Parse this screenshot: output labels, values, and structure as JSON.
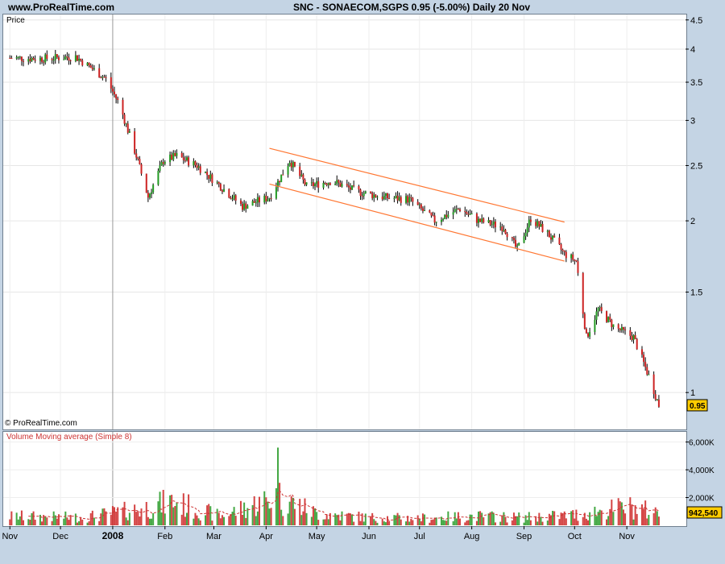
{
  "header": {
    "site": "www.ProRealTime.com",
    "title": "SNC - SONAECOM,SGPS   0.95 (-5.00%)   Daily  20 Nov"
  },
  "price_panel": {
    "label": "Price",
    "copyright": "© ProRealTime.com"
  },
  "volume_panel": {
    "label": "Volume Moving average (Simple 8)"
  },
  "colors": {
    "up": "#229922",
    "down": "#cc2222",
    "wick": "#000000",
    "channel": "#ff7733",
    "ma": "#cc3333",
    "last_badge": "#ffcc00"
  },
  "chart_data": [
    {
      "type": "candlestick",
      "title": "SNC - SONAECOM,SGPS",
      "ylabel": "Price",
      "scale": "log",
      "ylim": [
        0.87,
        4.6
      ],
      "yticks": [
        1,
        1.5,
        2,
        2.5,
        3,
        3.5,
        4,
        4.5
      ],
      "last_value": "0.95",
      "change": "-5.00%",
      "period": "Daily",
      "date": "20 Nov",
      "x_labels": [
        "Nov",
        "Dec",
        "2008",
        "Feb",
        "Mar",
        "Apr",
        "May",
        "Jun",
        "Jul",
        "Aug",
        "Sep",
        "Oct",
        "Nov"
      ],
      "close_path": [
        [
          "2007-11-01",
          3.86
        ],
        [
          "2007-11-20",
          3.85
        ],
        [
          "2007-12-10",
          3.88
        ],
        [
          "2007-12-28",
          3.55
        ],
        [
          "2008-01-05",
          3.2
        ],
        [
          "2008-01-15",
          2.6
        ],
        [
          "2008-01-22",
          2.2
        ],
        [
          "2008-01-31",
          2.55
        ],
        [
          "2008-02-08",
          2.6
        ],
        [
          "2008-02-20",
          2.5
        ],
        [
          "2008-03-05",
          2.3
        ],
        [
          "2008-03-18",
          2.12
        ],
        [
          "2008-04-03",
          2.2
        ],
        [
          "2008-04-15",
          2.55
        ],
        [
          "2008-04-25",
          2.3
        ],
        [
          "2008-05-10",
          2.35
        ],
        [
          "2008-05-25",
          2.25
        ],
        [
          "2008-06-10",
          2.2
        ],
        [
          "2008-06-25",
          2.18
        ],
        [
          "2008-07-10",
          2.0
        ],
        [
          "2008-07-25",
          2.1
        ],
        [
          "2008-08-05",
          2.0
        ],
        [
          "2008-08-20",
          1.95
        ],
        [
          "2008-08-28",
          1.78
        ],
        [
          "2008-09-05",
          2.02
        ],
        [
          "2008-09-15",
          1.9
        ],
        [
          "2008-09-25",
          1.75
        ],
        [
          "2008-10-02",
          1.7
        ],
        [
          "2008-10-08",
          1.25
        ],
        [
          "2008-10-15",
          1.4
        ],
        [
          "2008-10-25",
          1.3
        ],
        [
          "2008-11-05",
          1.25
        ],
        [
          "2008-11-15",
          1.05
        ],
        [
          "2008-11-20",
          0.95
        ]
      ],
      "channel": {
        "upper": [
          [
            "2008-04-03",
            2.68
          ],
          [
            "2008-09-25",
            1.99
          ]
        ],
        "lower": [
          [
            "2008-04-03",
            2.32
          ],
          [
            "2008-09-25",
            1.7
          ]
        ]
      }
    },
    {
      "type": "bar",
      "title": "Volume Moving average (Simple 8)",
      "yticks": [
        "2,000K",
        "4,000K",
        "6,000K"
      ],
      "ylim": [
        0,
        6500000
      ],
      "last_value": "942,540",
      "peak": [
        "2008-04-08",
        5600000
      ],
      "volume_path": [
        [
          "2007-11-01",
          700000
        ],
        [
          "2007-12-15",
          600000
        ],
        [
          "2008-01-20",
          1300000
        ],
        [
          "2008-02-05",
          1800000
        ],
        [
          "2008-03-05",
          700000
        ],
        [
          "2008-04-08",
          2200000
        ],
        [
          "2008-05-01",
          900000
        ],
        [
          "2008-06-01",
          600000
        ],
        [
          "2008-07-01",
          550000
        ],
        [
          "2008-08-01",
          700000
        ],
        [
          "2008-09-01",
          600000
        ],
        [
          "2008-10-01",
          800000
        ],
        [
          "2008-11-01",
          1400000
        ],
        [
          "2008-11-20",
          950000
        ]
      ]
    }
  ]
}
